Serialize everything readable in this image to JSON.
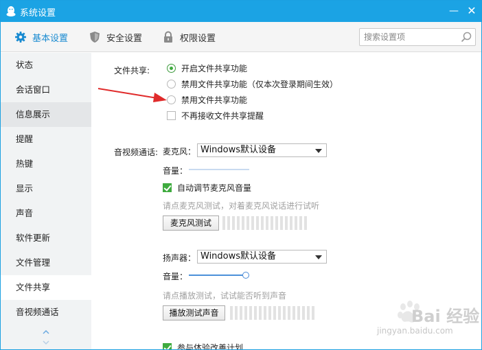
{
  "window": {
    "title": "系统设置",
    "minimize_glyph": "—",
    "close_glyph": "✕"
  },
  "tabs": [
    {
      "label": "基本设置",
      "icon": "gear-icon",
      "active": true
    },
    {
      "label": "安全设置",
      "icon": "shield-icon",
      "active": false
    },
    {
      "label": "权限设置",
      "icon": "lock-icon",
      "active": false
    }
  ],
  "search": {
    "placeholder": "搜索设置项",
    "value": ""
  },
  "sidebar": {
    "items": [
      {
        "label": "状态"
      },
      {
        "label": "会话窗口"
      },
      {
        "label": "信息展示"
      },
      {
        "label": "提醒"
      },
      {
        "label": "热键"
      },
      {
        "label": "显示"
      },
      {
        "label": "声音"
      },
      {
        "label": "软件更新"
      },
      {
        "label": "文件管理"
      },
      {
        "label": "文件共享",
        "selected": true
      },
      {
        "label": "音视频通话"
      }
    ]
  },
  "file_share": {
    "label": "文件共享:",
    "options": [
      {
        "label": "开启文件共享功能",
        "checked": true
      },
      {
        "label": "禁用文件共享功能（仅本次登录期间生效）",
        "checked": false
      },
      {
        "label": "禁用文件共享功能",
        "checked": false
      }
    ],
    "no_remind": {
      "label": "不再接收文件共享提醒",
      "checked": false
    }
  },
  "av_call": {
    "label": "音视频通话:",
    "mic": {
      "label": "麦克风：",
      "device": "Windows默认设备",
      "volume_label": "音量：",
      "volume_level": 0.0,
      "auto_adjust": {
        "label": "自动调节麦克风音量",
        "checked": true
      },
      "hint": "请点麦克风测试，对着麦克风说话进行试听",
      "test_button": "麦克风测试"
    },
    "speaker": {
      "label": "扬声器：",
      "device": "Windows默认设备",
      "volume_label": "音量：",
      "volume_level": 1.0,
      "hint": "请点播放测试，试试能否听到声音",
      "test_button": "播放测试声音"
    }
  },
  "experience_plan": {
    "label": "参与体验改善计划",
    "checked": true
  },
  "watermark": {
    "text": "Bai 经验",
    "sub": "jingyan.baidu.com"
  },
  "colors": {
    "titlebar": "#1ba3e4",
    "accent": "#1a8bd1",
    "check_green": "#3fab3f",
    "annotation_arrow": "#e02b2b"
  }
}
